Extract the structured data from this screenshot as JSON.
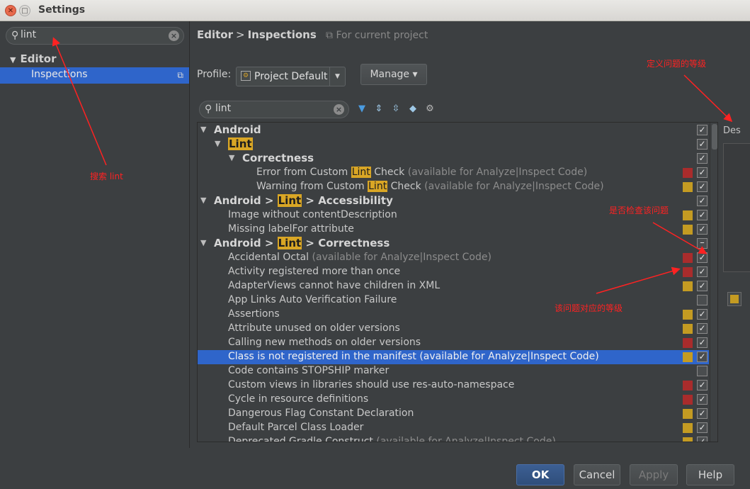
{
  "window": {
    "title": "Settings"
  },
  "left": {
    "search_value": "lint",
    "tree": {
      "editor": "Editor",
      "inspections": "Inspections"
    }
  },
  "header": {
    "crumb_editor": "Editor",
    "crumb_sep": ">",
    "crumb_inspections": "Inspections",
    "scope": "For current project",
    "profile_label": "Profile:",
    "profile_value": "Project Default",
    "manage_label": "Manage",
    "list_search_value": "lint"
  },
  "rows": [
    {
      "type": "group",
      "indent": 0,
      "parts": [
        "Android"
      ],
      "check": "checked"
    },
    {
      "type": "group",
      "indent": 1,
      "parts": [
        {
          "hl": "Lint"
        }
      ],
      "check": "checked"
    },
    {
      "type": "group",
      "indent": 2,
      "parts": [
        "Correctness"
      ],
      "check": "checked"
    },
    {
      "type": "item",
      "indent": 3,
      "parts": [
        "Error from Custom ",
        {
          "hl": "Lint"
        },
        " Check",
        {
          "note": " (available for Analyze|Inspect Code)"
        }
      ],
      "severity": "error",
      "check": "checked"
    },
    {
      "type": "item",
      "indent": 3,
      "parts": [
        "Warning from Custom ",
        {
          "hl": "Lint"
        },
        " Check",
        {
          "note": " (available for Analyze|Inspect Code)"
        }
      ],
      "severity": "warning",
      "check": "checked"
    },
    {
      "type": "group",
      "indent": 0,
      "parts": [
        "Android > ",
        {
          "hl": "Lint"
        },
        " > Accessibility"
      ],
      "check": "checked"
    },
    {
      "type": "item",
      "indent": 1,
      "parts": [
        "Image without contentDescription"
      ],
      "severity": "warning",
      "check": "checked"
    },
    {
      "type": "item",
      "indent": 1,
      "parts": [
        "Missing labelFor attribute"
      ],
      "severity": "warning",
      "check": "checked"
    },
    {
      "type": "group",
      "indent": 0,
      "parts": [
        "Android > ",
        {
          "hl": "Lint"
        },
        " > Correctness"
      ],
      "check": "partial"
    },
    {
      "type": "item",
      "indent": 1,
      "parts": [
        "Accidental Octal",
        {
          "note": " (available for Analyze|Inspect Code)"
        }
      ],
      "severity": "error",
      "check": "checked"
    },
    {
      "type": "item",
      "indent": 1,
      "parts": [
        "Activity registered more than once"
      ],
      "severity": "error",
      "check": "checked"
    },
    {
      "type": "item",
      "indent": 1,
      "parts": [
        "AdapterViews cannot have children in XML"
      ],
      "severity": "warning",
      "check": "checked"
    },
    {
      "type": "item",
      "indent": 1,
      "parts": [
        "App Links Auto Verification Failure"
      ],
      "severity": "none",
      "check": "unchecked"
    },
    {
      "type": "item",
      "indent": 1,
      "parts": [
        "Assertions"
      ],
      "severity": "warning",
      "check": "checked"
    },
    {
      "type": "item",
      "indent": 1,
      "parts": [
        "Attribute unused on older versions"
      ],
      "severity": "warning",
      "check": "checked"
    },
    {
      "type": "item",
      "indent": 1,
      "parts": [
        "Calling new methods on older versions"
      ],
      "severity": "error",
      "check": "checked"
    },
    {
      "type": "item",
      "indent": 1,
      "parts": [
        "Class is not registered in the manifest (available for Analyze|Inspect Code)"
      ],
      "severity": "warning",
      "check": "checked",
      "selected": true
    },
    {
      "type": "item",
      "indent": 1,
      "parts": [
        "Code contains STOPSHIP marker"
      ],
      "severity": "none",
      "check": "unchecked"
    },
    {
      "type": "item",
      "indent": 1,
      "parts": [
        "Custom views in libraries should use res-auto-namespace"
      ],
      "severity": "error",
      "check": "checked"
    },
    {
      "type": "item",
      "indent": 1,
      "parts": [
        "Cycle in resource definitions"
      ],
      "severity": "error",
      "check": "checked"
    },
    {
      "type": "item",
      "indent": 1,
      "parts": [
        "Dangerous Flag Constant Declaration"
      ],
      "severity": "warning",
      "check": "checked"
    },
    {
      "type": "item",
      "indent": 1,
      "parts": [
        "Default Parcel Class Loader"
      ],
      "severity": "warning",
      "check": "checked"
    },
    {
      "type": "item",
      "indent": 1,
      "parts": [
        "Deprecated Gradle Construct",
        {
          "note": " (available for Analyze|Inspect Code)"
        }
      ],
      "severity": "warning",
      "check": "checked"
    }
  ],
  "description": {
    "label": "Des"
  },
  "buttons": {
    "ok": "OK",
    "cancel": "Cancel",
    "apply": "Apply",
    "help": "Help"
  },
  "annotations": {
    "search_lint": "搜索 lint",
    "define_level": "定义问题的等级",
    "check_or_not": "是否检查该问题",
    "problem_level": "该问题对应的等级"
  },
  "colors": {
    "selection": "#2f65ca",
    "error": "#a92c2c",
    "warning": "#c49b22",
    "highlight": "#d9a625",
    "annotation": "#ff2222"
  }
}
